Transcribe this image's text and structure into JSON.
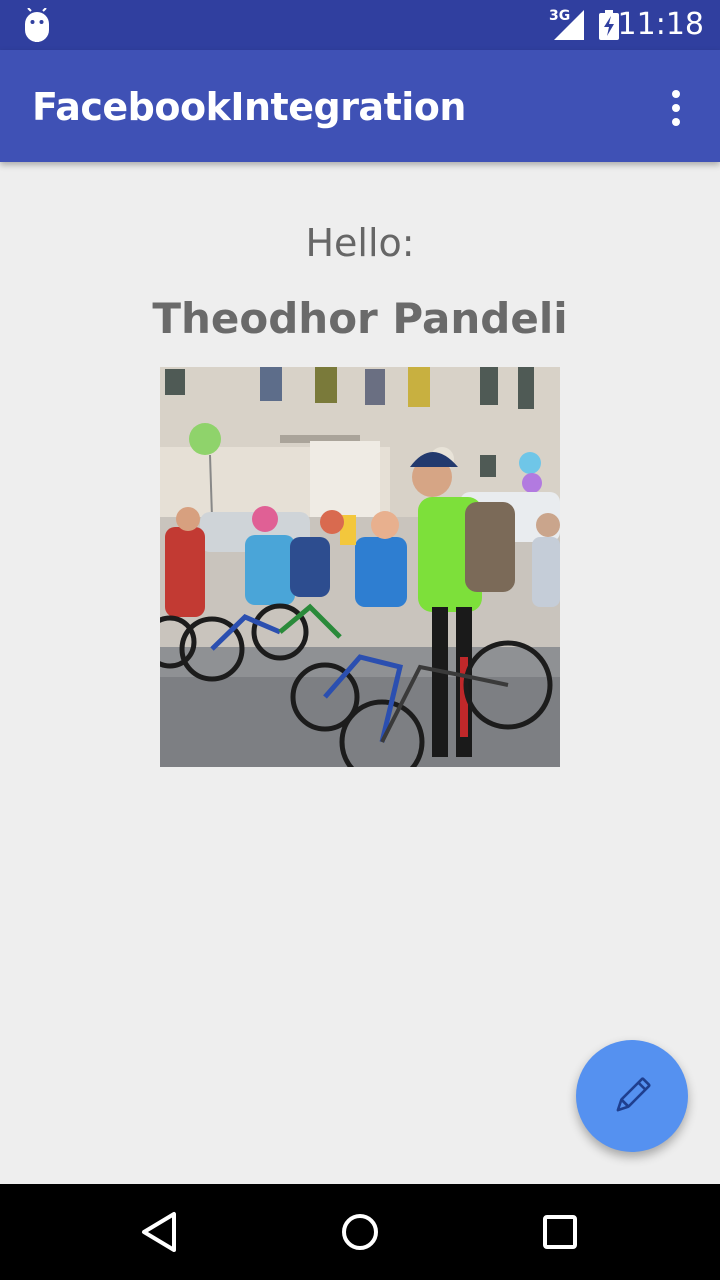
{
  "status_bar": {
    "network_type": "3G",
    "time": "11:18",
    "icons": [
      "android-debug-icon",
      "signal-icon",
      "battery-charging-icon"
    ]
  },
  "app_bar": {
    "title": "FacebookIntegration",
    "menu_icon": "overflow-menu-icon"
  },
  "content": {
    "greeting": "Hello:",
    "user_name": "Theodhor Pandeli",
    "profile_image": "group-of-cyclists-photo"
  },
  "fab": {
    "icon": "edit-pencil-icon",
    "color": "#5591f0"
  },
  "navigation_bar": {
    "buttons": [
      "back-icon",
      "home-icon",
      "recents-icon"
    ]
  },
  "colors": {
    "status_bar": "#303f9f",
    "app_bar": "#3f51b5",
    "background": "#eeeeee",
    "text_secondary": "#666666"
  }
}
